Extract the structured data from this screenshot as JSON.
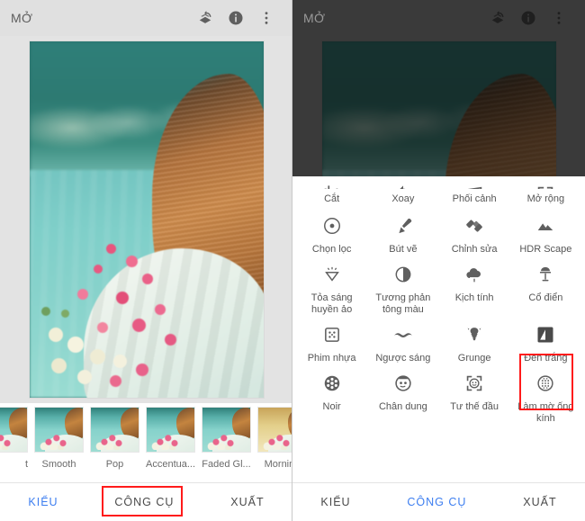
{
  "app": {
    "title": "MỞ",
    "actions": [
      {
        "name": "layers-undo-icon",
        "label": "Layers / Undo"
      },
      {
        "name": "info-icon",
        "label": "Info"
      },
      {
        "name": "more-vert-icon",
        "label": "More options"
      }
    ]
  },
  "left_panel": {
    "appbar_title": "MỞ",
    "filmstrip": [
      {
        "label": "t",
        "partial": true
      },
      {
        "label": "Smooth"
      },
      {
        "label": "Pop"
      },
      {
        "label": "Accentua..."
      },
      {
        "label": "Faded Gl..."
      },
      {
        "label": "Morning"
      },
      {
        "label": "",
        "partial_right": true
      }
    ],
    "tabs": [
      {
        "label": "KIỂU",
        "active": true
      },
      {
        "label": "CÔNG CỤ",
        "active": false,
        "highlighted": true
      },
      {
        "label": "XUẤT",
        "active": false
      }
    ]
  },
  "right_panel": {
    "appbar_title": "MỞ",
    "tools": [
      {
        "label": "Cắt",
        "icon": "crop-icon"
      },
      {
        "label": "Xoay",
        "icon": "rotate-icon"
      },
      {
        "label": "Phối cảnh",
        "icon": "perspective-icon"
      },
      {
        "label": "Mở rộng",
        "icon": "expand-icon"
      },
      {
        "label": "Chọn lọc",
        "icon": "selective-icon"
      },
      {
        "label": "Bút vẽ",
        "icon": "brush-icon"
      },
      {
        "label": "Chỉnh sửa",
        "icon": "healing-icon"
      },
      {
        "label": "HDR Scape",
        "icon": "mountain-icon"
      },
      {
        "label": "Tỏa sáng huyền ảo",
        "icon": "glamour-glow-icon"
      },
      {
        "label": "Tương phản tông màu",
        "icon": "tonal-contrast-icon"
      },
      {
        "label": "Kịch tính",
        "icon": "drama-cloud-icon"
      },
      {
        "label": "Cổ điển",
        "icon": "vintage-lamp-icon"
      },
      {
        "label": "Phim nhựa",
        "icon": "grainy-film-icon"
      },
      {
        "label": "Ngược sáng",
        "icon": "retrolux-icon"
      },
      {
        "label": "Grunge",
        "icon": "grunge-icon"
      },
      {
        "label": "Đen trắng",
        "icon": "black-white-icon",
        "highlighted": true
      },
      {
        "label": "Noir",
        "icon": "film-reel-icon"
      },
      {
        "label": "Chân dung",
        "icon": "portrait-face-icon"
      },
      {
        "label": "Tư thế đầu",
        "icon": "head-pose-icon"
      },
      {
        "label": "Làm mờ ống kính",
        "icon": "lens-blur-icon"
      }
    ],
    "tabs": [
      {
        "label": "KIỂU",
        "active": false
      },
      {
        "label": "CÔNG CỤ",
        "active": true
      },
      {
        "label": "XUẤT",
        "active": false
      }
    ]
  },
  "colors": {
    "accent_blue": "#3d7ef0",
    "highlight_red": "#ff1a1a",
    "appbar_light": "#e0e0e0",
    "appbar_dim": "#3a3a3a",
    "icon_gray": "#5f5f5f",
    "label_gray": "#555555"
  }
}
